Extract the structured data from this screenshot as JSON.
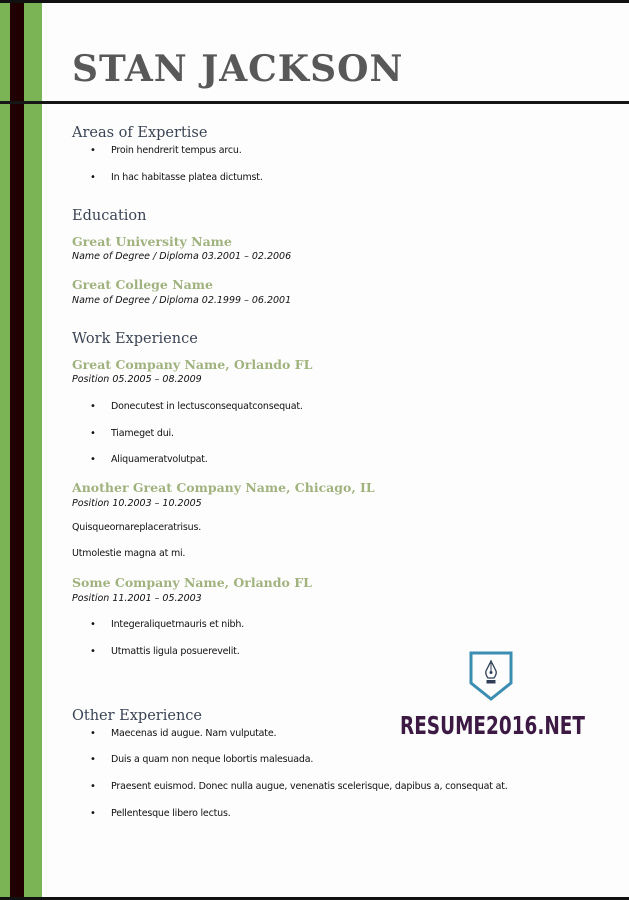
{
  "colors": {
    "accent_green": "#7ab455",
    "dark_bar": "#200000",
    "name_gray": "#585858",
    "heading_slate": "#3b4454",
    "org_sage": "#a0b27e",
    "logo_purple": "#3d1a44",
    "logo_blue": "#3b8db1"
  },
  "name": "STAN JACKSON",
  "sections": {
    "expertise": {
      "title": "Areas of Expertise",
      "bullets": [
        "Proin hendrerit tempus arcu.",
        "In hac habitasse platea dictumst."
      ]
    },
    "education": {
      "title": "Education",
      "entries": [
        {
          "org": "Great University Name",
          "meta": "Name of Degree / Diploma 03.2001 – 02.2006"
        },
        {
          "org": "Great College Name",
          "meta": "Name of Degree / Diploma 02.1999 – 06.2001"
        }
      ]
    },
    "work": {
      "title": "Work Experience",
      "jobs": [
        {
          "org": "Great Company Name, Orlando FL",
          "meta": "Position 05.2005 – 08.2009",
          "bullets": [
            "Donecutest in lectusconsequatconsequat.",
            "Tiameget dui.",
            "Aliquameratvolutpat."
          ]
        },
        {
          "org": "Another Great Company Name, Chicago, IL",
          "meta": "Position 10.2003 – 10.2005",
          "lines": [
            "Quisqueornareplaceratrisus.",
            "Utmolestie magna at mi."
          ]
        },
        {
          "org": "Some Company Name, Orlando FL",
          "meta": "Position 11.2001 – 05.2003",
          "bullets": [
            "Integeraliquetmauris et nibh.",
            "Utmattis ligula posuerevelit."
          ]
        }
      ]
    },
    "other": {
      "title": "Other Experience",
      "bullets": [
        "Maecenas id augue. Nam vulputate.",
        "Duis a quam non neque lobortis malesuada.",
        "Praesent euismod. Donec nulla augue, venenatis scelerisque, dapibus a, consequat at.",
        "Pellentesque libero lectus."
      ]
    }
  },
  "bullet_glyph": "•",
  "logo": {
    "icon": "pen-nib-shield-icon",
    "text": "RESUME2016.NET"
  }
}
